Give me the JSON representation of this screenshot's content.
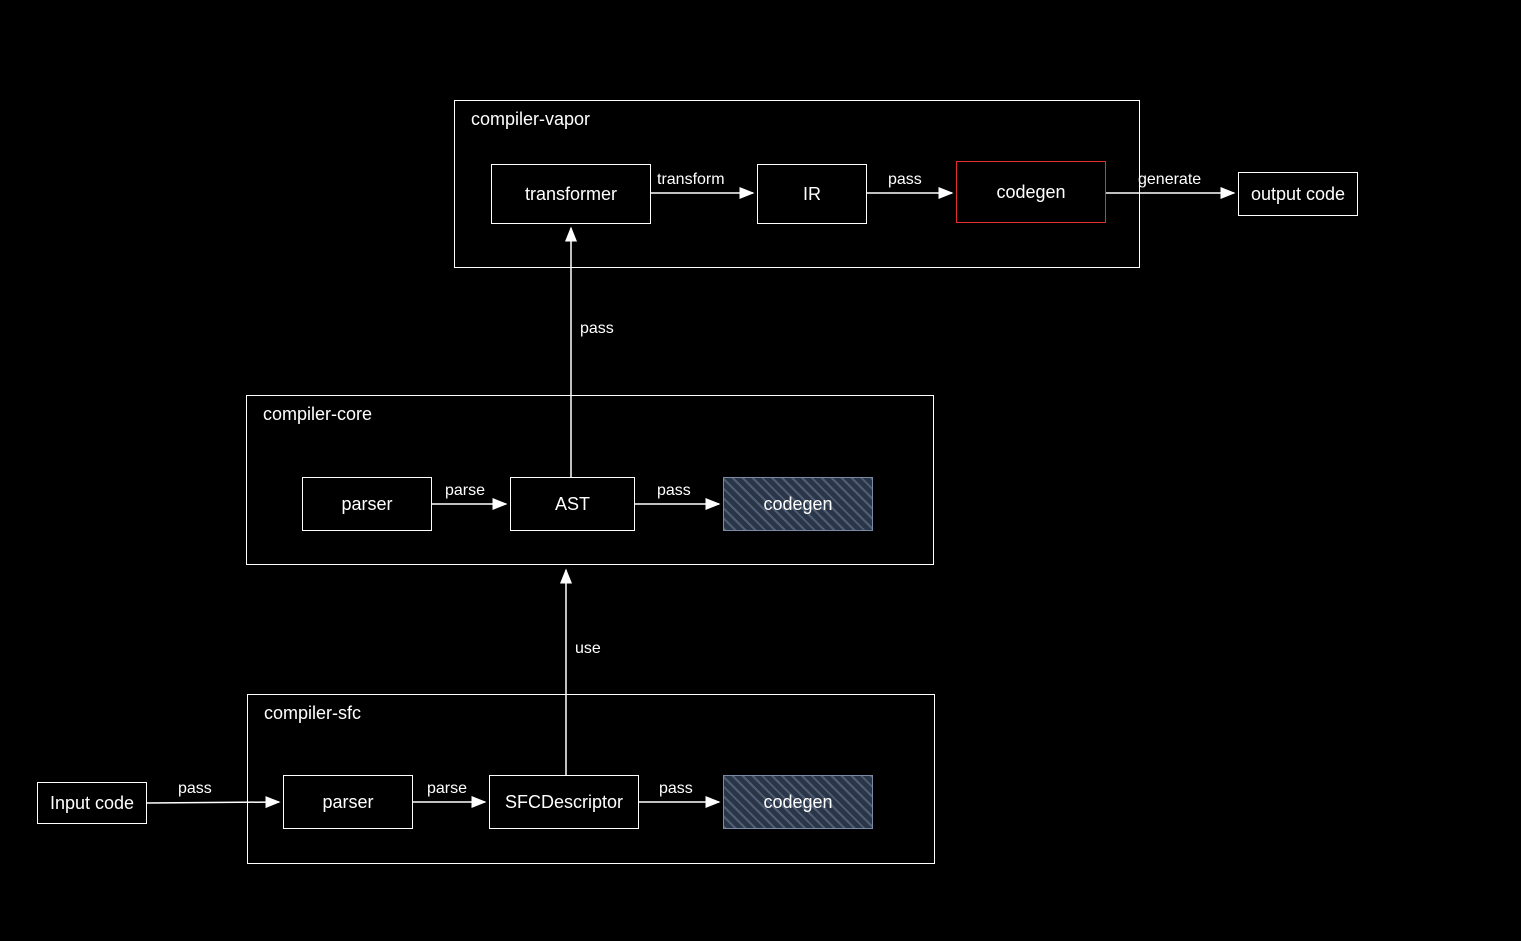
{
  "groups": {
    "vapor": {
      "title": "compiler-vapor"
    },
    "core": {
      "title": "compiler-core"
    },
    "sfc": {
      "title": "compiler-sfc"
    }
  },
  "nodes": {
    "input_code": {
      "label": "Input code"
    },
    "sfc_parser": {
      "label": "parser"
    },
    "sfc_descriptor": {
      "label": "SFCDescriptor"
    },
    "sfc_codegen": {
      "label": "codegen"
    },
    "core_parser": {
      "label": "parser"
    },
    "core_ast": {
      "label": "AST"
    },
    "core_codegen": {
      "label": "codegen"
    },
    "transformer": {
      "label": "transformer"
    },
    "ir": {
      "label": "IR"
    },
    "vapor_codegen": {
      "label": "codegen"
    },
    "output_code": {
      "label": "output code"
    }
  },
  "edges": {
    "pass_input_sfc": {
      "label": "pass"
    },
    "parse_sfc": {
      "label": "parse"
    },
    "pass_desc_codegen": {
      "label": "pass"
    },
    "use_sfc_core": {
      "label": "use"
    },
    "parse_core": {
      "label": "parse"
    },
    "pass_ast_codegen": {
      "label": "pass"
    },
    "pass_ast_vapor": {
      "label": "pass"
    },
    "transform": {
      "label": "transform"
    },
    "pass_ir_codegen": {
      "label": "pass"
    },
    "generate": {
      "label": "generate"
    }
  }
}
